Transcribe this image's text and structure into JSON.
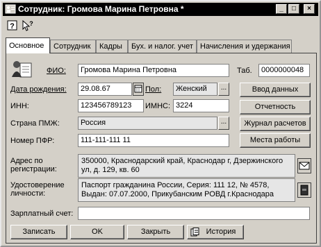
{
  "window": {
    "title": "Сотрудник: Громова Марина Петровна *",
    "minimize": "_",
    "maximize": "□",
    "close": "×"
  },
  "toolbar": {
    "help_glyph": "?",
    "whatsthis_glyph": "?"
  },
  "tabs": [
    {
      "label": "Основное",
      "active": true
    },
    {
      "label": "Сотрудник"
    },
    {
      "label": "Кадры"
    },
    {
      "label": "Бух. и налог. учет"
    },
    {
      "label": "Начисления и удержания"
    }
  ],
  "form": {
    "fio_label": "ФИО:",
    "fio_value": "Громова Марина Петровна",
    "tab_label": "Таб.",
    "tab_value": "0000000048",
    "birth_label": "Дата рождения:",
    "birth_value": "29.08.67",
    "sex_label": "Пол:",
    "sex_value": "Женский",
    "inn_label": "ИНН:",
    "inn_value": "123456789123",
    "imns_label": "ИМНС:",
    "imns_value": "3224",
    "country_label": "Страна ПМЖ:",
    "country_value": "Россия",
    "pfr_label": "Номер ПФР:",
    "pfr_value": "111-111-111 11",
    "address_label_1": "Адрес по",
    "address_label_2": "регистрации:",
    "address_value": "350000, Краснодарский край, Краснодар г, Дзержинского ул, д. 129, кв. 60",
    "id_label_1": "Удостоверение",
    "id_label_2": "личности:",
    "id_value": "Паспорт гражданина России, Серия: 111 12, № 4578, Выдан: 07.07.2000, Прикубанским РОВД г.Краснодара",
    "salary_label": "Зарплатный счет:",
    "salary_value": "",
    "ellipsis": "..."
  },
  "side_buttons": {
    "data_entry": "Ввод данных",
    "reports": "Отчетность",
    "journal": "Журнал расчетов",
    "workplaces": "Места работы"
  },
  "bottom_buttons": {
    "save": "Записать",
    "ok": "OK",
    "close": "Закрыть",
    "history": "История"
  }
}
